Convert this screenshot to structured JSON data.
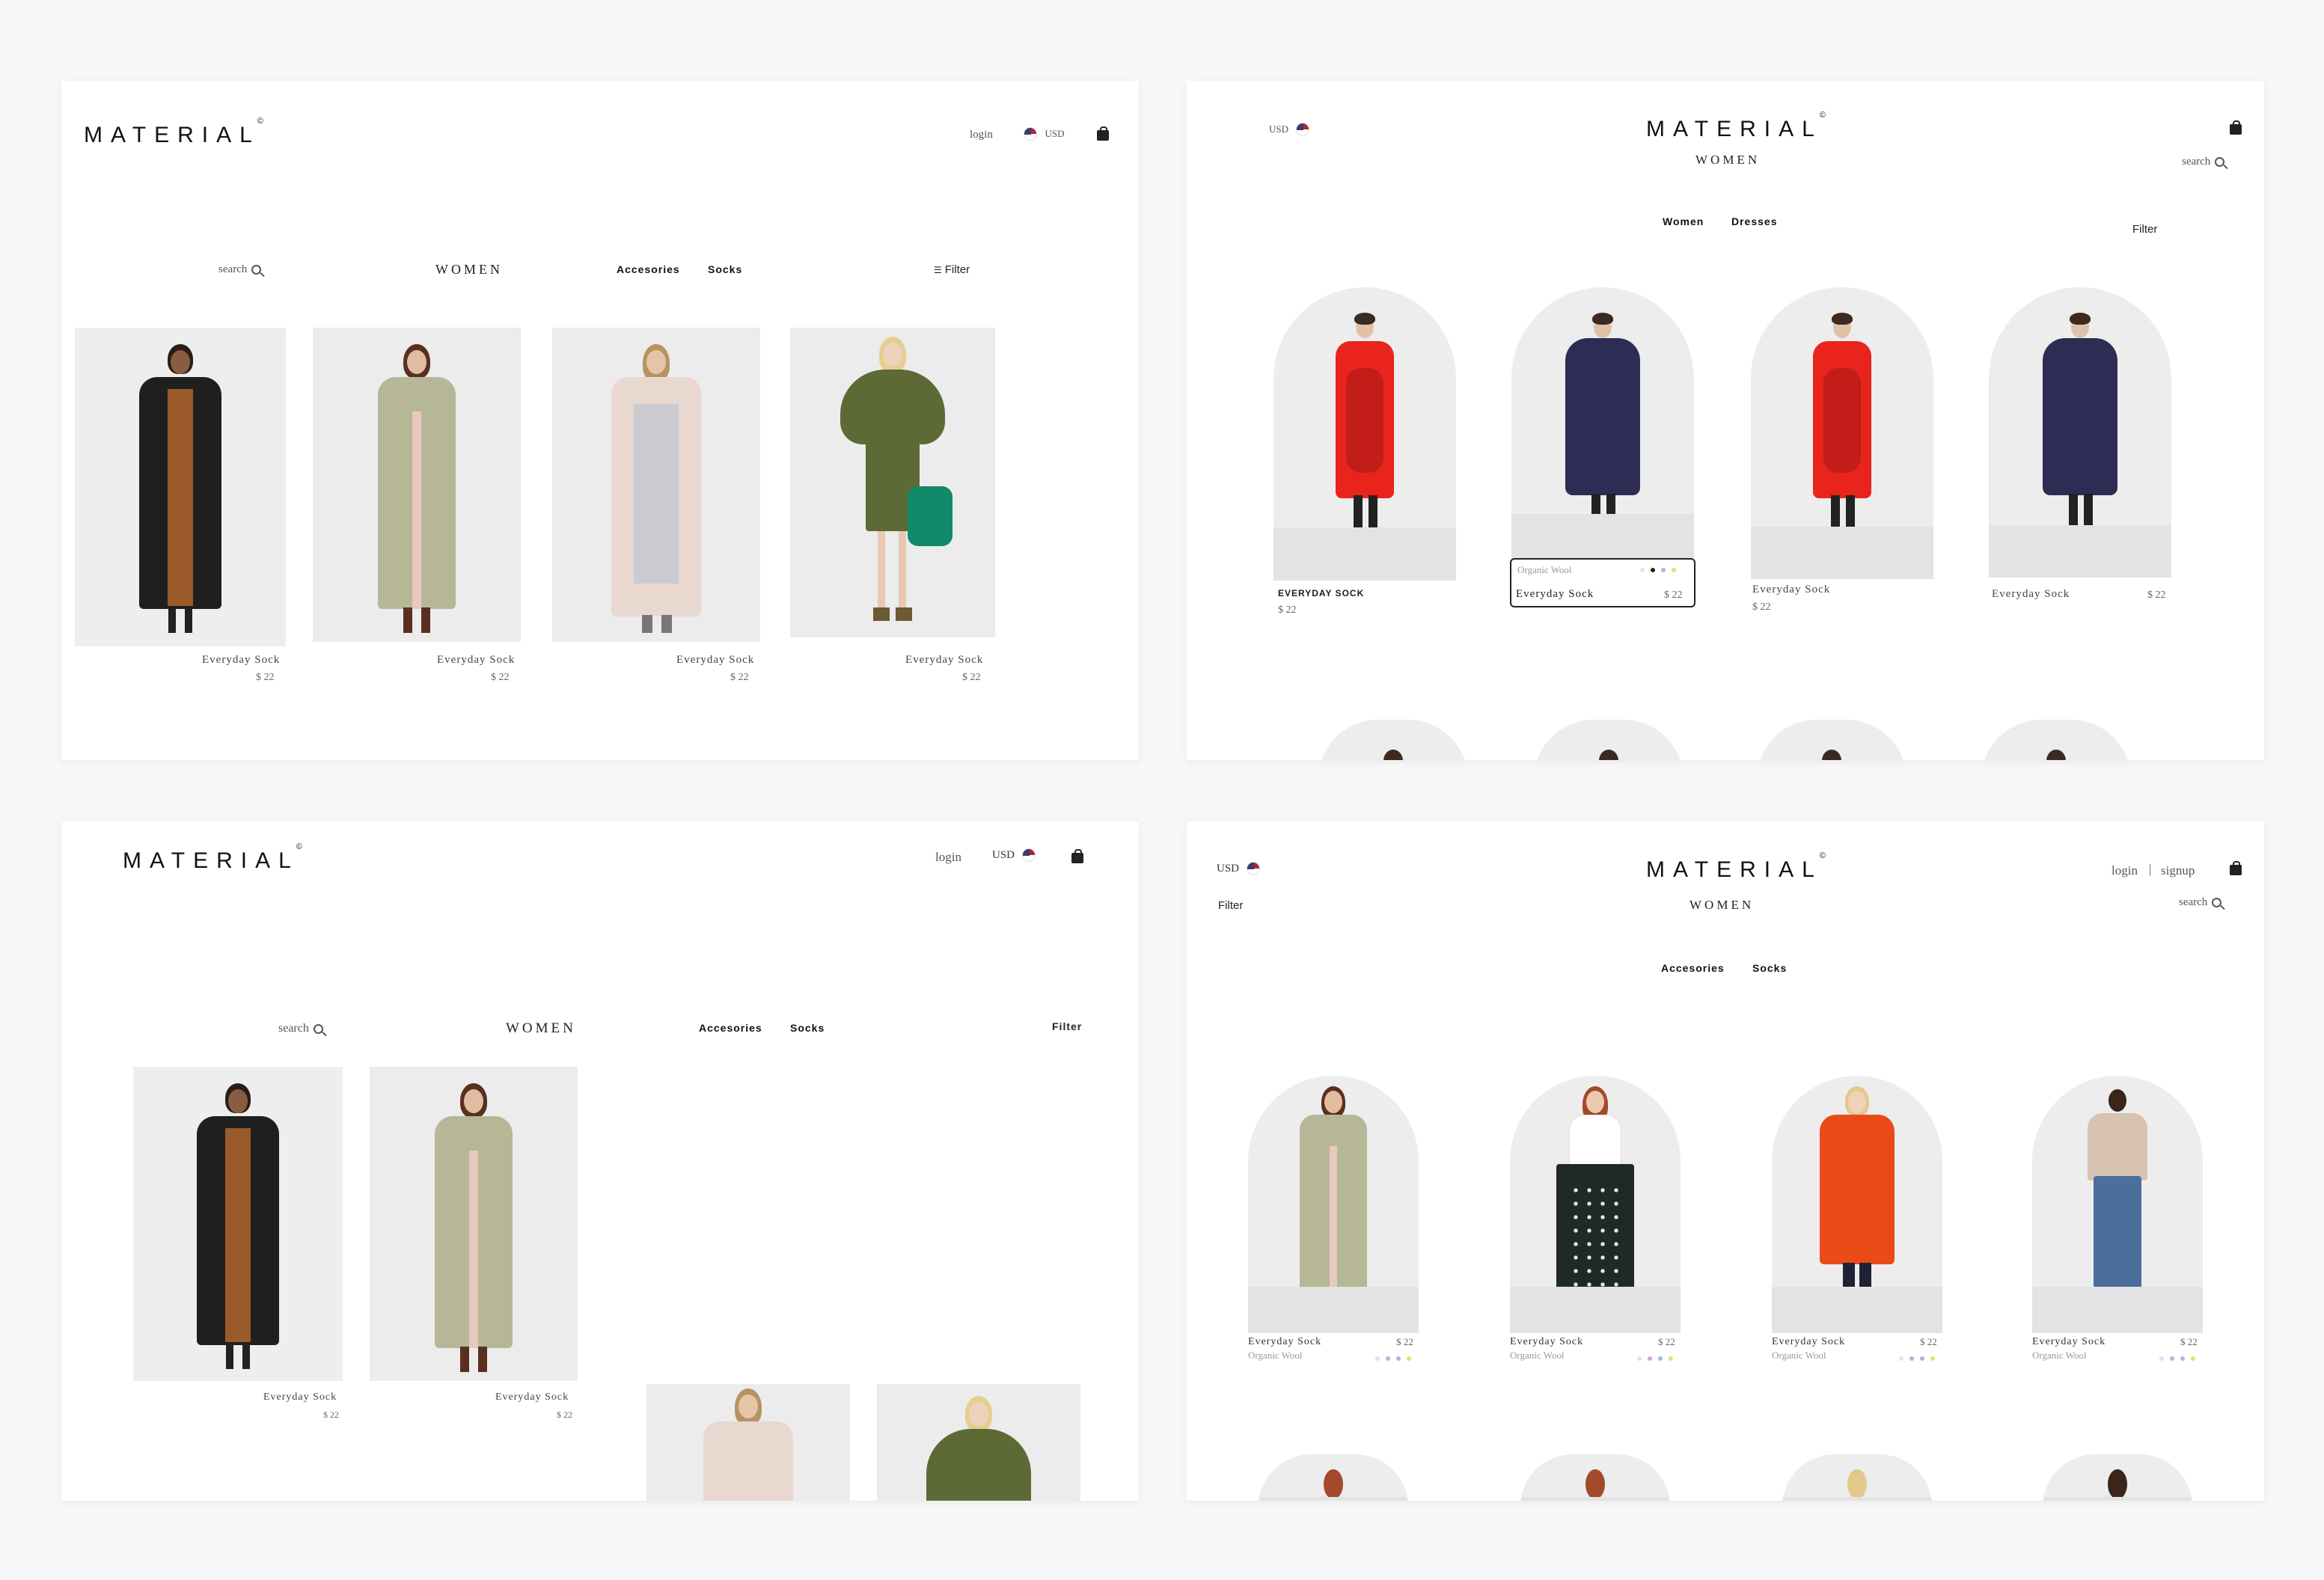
{
  "colors": {
    "background": "#f7f7f7",
    "panel": "#ffffff",
    "text": "#1b1b1b"
  },
  "panels": {
    "top_left": {
      "logo": "MATERIAL",
      "logo_mark": "©",
      "login": "login",
      "currency": "USD",
      "search": "search",
      "title": "WOMEN",
      "nav": [
        "Accesories",
        "Socks"
      ],
      "filter": "Filter",
      "products": [
        {
          "name": "Everyday Sock",
          "price": "$ 22"
        },
        {
          "name": "Everyday Sock",
          "price": "$ 22"
        },
        {
          "name": "Everyday Sock",
          "price": "$ 22"
        },
        {
          "name": "Everyday Sock",
          "price": "$ 22"
        }
      ]
    },
    "top_right": {
      "logo": "MATERIAL",
      "logo_mark": "©",
      "currency": "USD",
      "search": "search",
      "title": "WOMEN",
      "nav": [
        "Women",
        "Dresses"
      ],
      "filter": "Filter",
      "products": [
        {
          "name": "EVERYDAY SOCK",
          "price": "$ 22"
        },
        {
          "name": "Everyday Sock",
          "price": "$ 22",
          "material": "Organic Wool"
        },
        {
          "name": "Everyday Sock",
          "price": "$ 22"
        },
        {
          "name": "Everyday Sock",
          "price": "$ 22"
        }
      ]
    },
    "bottom_left": {
      "logo": "MATERIAL",
      "logo_mark": "©",
      "login": "login",
      "currency": "USD",
      "search": "search",
      "title": "WOMEN",
      "nav": [
        "Accesories",
        "Socks"
      ],
      "filter": "Filter",
      "products": [
        {
          "name": "Everyday Sock",
          "price": "$ 22"
        },
        {
          "name": "Everyday Sock",
          "price": "$ 22"
        }
      ]
    },
    "bottom_right": {
      "logo": "MATERIAL",
      "logo_mark": "©",
      "currency": "USD",
      "login": "login",
      "signup": "signup",
      "separator": "|",
      "filter": "Filter",
      "title": "WOMEN",
      "search": "search",
      "nav": [
        "Accesories",
        "Socks"
      ],
      "products": [
        {
          "name": "Everyday Sock",
          "price": "$ 22",
          "material": "Organic Wool"
        },
        {
          "name": "Everyday Sock",
          "price": "$ 22",
          "material": "Organic Wool"
        },
        {
          "name": "Everyday Sock",
          "price": "$ 22",
          "material": "Organic Wool"
        },
        {
          "name": "Everyday Sock",
          "price": "$ 22",
          "material": "Organic Wool"
        }
      ]
    }
  },
  "swatch_colors": [
    "#e2e2e2",
    "#c7a9dd",
    "#a3b8e6",
    "#d7e86a"
  ],
  "icons": [
    "us-flag-icon",
    "shopping-bag-icon",
    "search-icon",
    "filter-icon"
  ]
}
